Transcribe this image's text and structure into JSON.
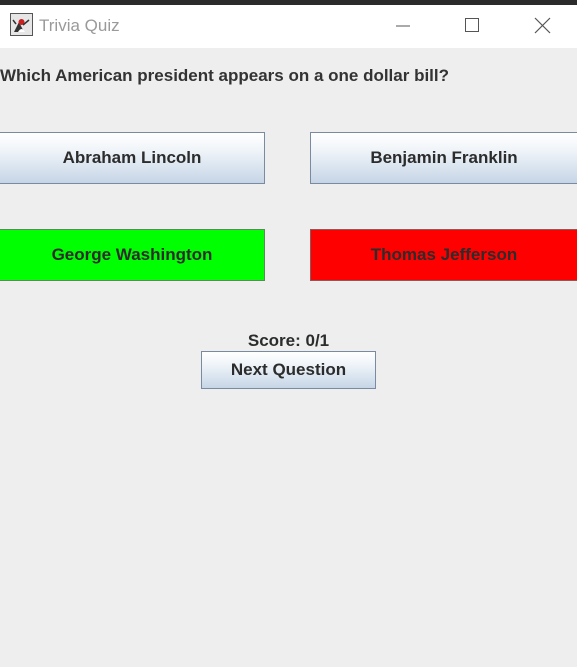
{
  "window": {
    "title": "Trivia Quiz",
    "app_icon": "java-duke-icon"
  },
  "titlebar_controls": {
    "minimize_icon": "minimize-icon",
    "maximize_icon": "maximize-icon",
    "close_icon": "close-icon"
  },
  "quiz": {
    "question": "Which American president appears on a one dollar bill?",
    "answers": [
      {
        "label": "Abraham Lincoln",
        "state": "default"
      },
      {
        "label": "Benjamin Franklin",
        "state": "default"
      },
      {
        "label": "George Washington",
        "state": "correct"
      },
      {
        "label": "Thomas Jefferson",
        "state": "wrong"
      }
    ],
    "score_text": "Score: 0/1",
    "next_label": "Next Question"
  },
  "colors": {
    "window_background": "#eeeeee",
    "correct": "#00ff00",
    "wrong": "#ff0000",
    "title_text": "#9a9a9a"
  }
}
